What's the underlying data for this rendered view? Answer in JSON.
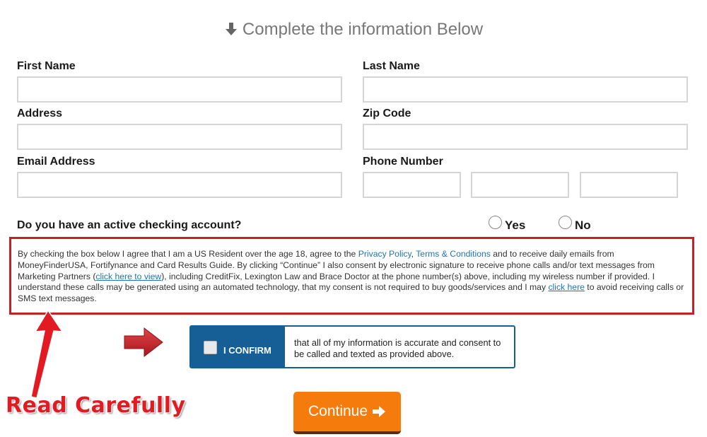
{
  "heading": {
    "text": "Complete the information Below",
    "icon": "arrow-down-icon"
  },
  "form": {
    "first_name": {
      "label": "First Name",
      "value": "",
      "placeholder": ""
    },
    "last_name": {
      "label": "Last Name",
      "value": "",
      "placeholder": ""
    },
    "address": {
      "label": "Address",
      "value": "",
      "placeholder": ""
    },
    "zip_code": {
      "label": "Zip Code",
      "value": "",
      "placeholder": ""
    },
    "email": {
      "label": "Email Address",
      "value": "",
      "placeholder": ""
    },
    "phone": {
      "label": "Phone Number",
      "area_code": "",
      "prefix": "",
      "line": ""
    },
    "checking": {
      "question": "Do you have an active checking account?",
      "options": [
        "Yes",
        "No"
      ],
      "selected": null
    }
  },
  "disclaimer": {
    "p1": "By checking the box below I agree that I am a US Resident over the age 18, agree to the ",
    "privacy_link": "Privacy Policy",
    "sep": ", ",
    "terms_link": "Terms & Conditions",
    "p2": " and to receive daily emails from MoneyFinderUSA, Fortifynance and Card Results Guide. By clicking “Continue” I also consent by electronic signature to receive phone calls and/or text messages from Marketing Partners (",
    "view_link": "click here to view",
    "p3": "), including CreditFix, Lexington Law and Brace Doctor at the phone number(s) above, including my wireless number if provided. I understand these calls may be generated using an automated technology, that my consent is not required to buy goods/services and I may ",
    "optout_link": "click here",
    "p4": " to avoid receiving calls or SMS text messages."
  },
  "confirm": {
    "label": "I CONFIRM",
    "text": "that all of my information is accurate and consent to be called and texted as provided above.",
    "checked": false
  },
  "continue_button": {
    "label": "Continue",
    "icon": "arrow-right-icon"
  },
  "annotation": {
    "text": "Read Carefully"
  },
  "colors": {
    "accent_blue": "#155e96",
    "continue_orange": "#f57b0c",
    "warning_red": "#c71f26",
    "link_blue": "#1d74b7"
  }
}
